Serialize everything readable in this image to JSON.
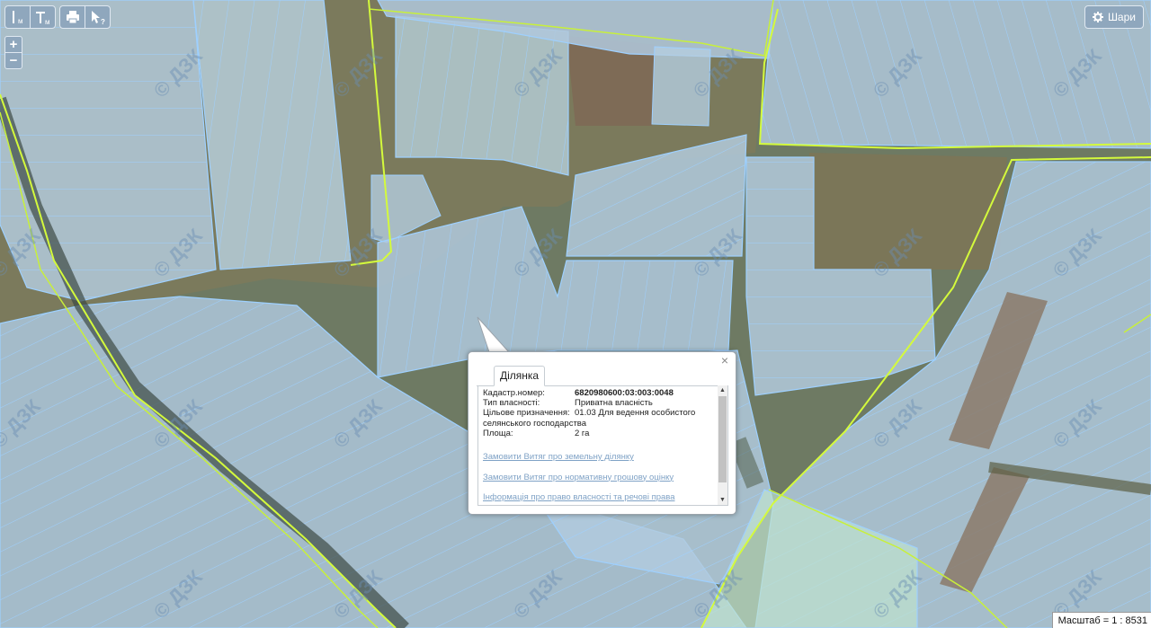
{
  "map": {
    "watermark": "© ДЗК",
    "colors": {
      "parcel_fill": "#adc9e3",
      "parcel_outline": "#9ed0ff",
      "boundary": "#c8f03a",
      "highlight": "#d4fa3c"
    }
  },
  "toolbar": {
    "measure_distance_label": "м",
    "measure_area_label": "м",
    "print_icon": "printer-icon",
    "identify_icon": "pointer-help-icon"
  },
  "zoom": {
    "in_label": "+",
    "out_label": "−"
  },
  "layers_button": {
    "label": "Шари",
    "icon": "gear-icon"
  },
  "popup": {
    "tab_label": "Ділянка",
    "close_label": "×",
    "fields": {
      "cadastral_label": "Кадастр.номер:",
      "cadastral_value": "6820980600:03:003:0048",
      "ownership_label": "Тип власності:",
      "ownership_value": "Приватна власність",
      "purpose_label": "Цільове призначення:",
      "purpose_value": "01.03 Для ведення особистого",
      "purpose_value_cont": "селянського господарства",
      "area_label": "Площа:",
      "area_value": "2 га"
    },
    "links": [
      "Замовити Витяг про земельну ділянку",
      "Замовити Витяг про нормативну грошову оцінку",
      "Інформація про право власності та речові права"
    ],
    "scroll_up": "▲",
    "scroll_down": "▼"
  },
  "scale": {
    "label": "Масштаб = 1 : 8531"
  }
}
